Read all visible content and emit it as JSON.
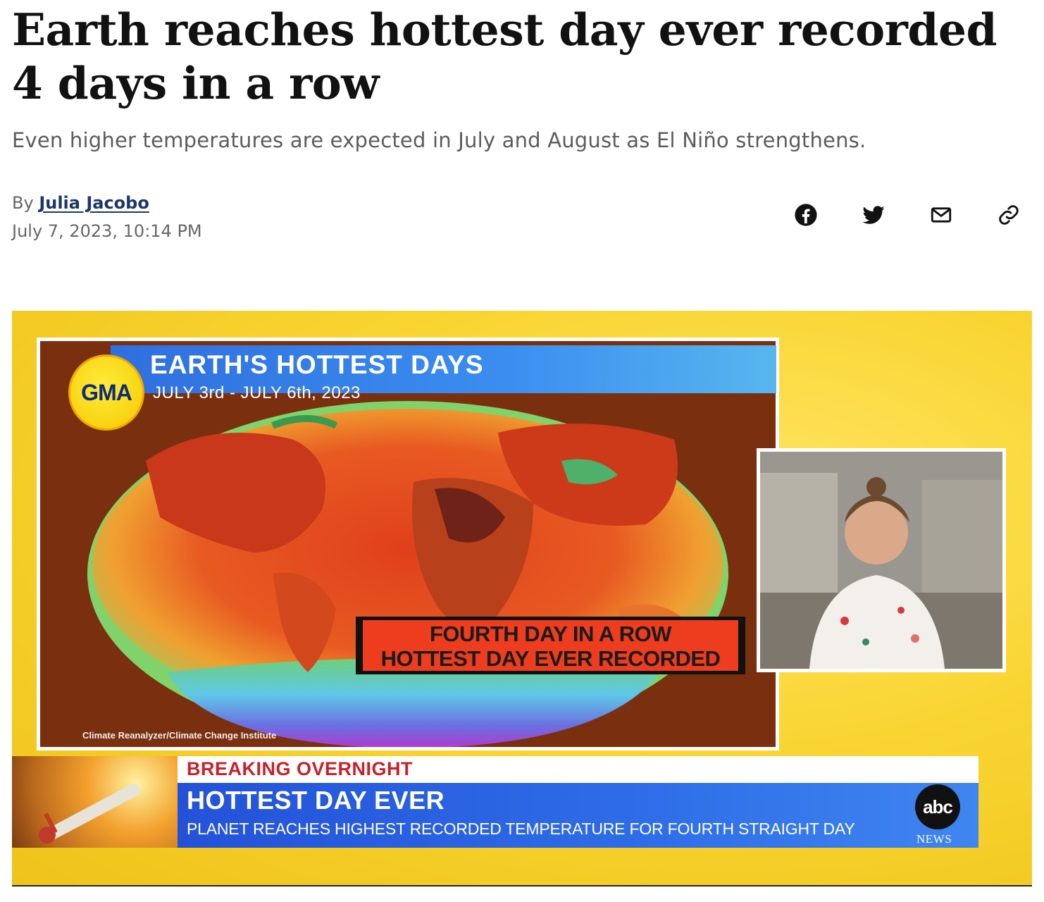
{
  "article": {
    "headline": "Earth reaches hottest day ever recorded 4 days in a row",
    "subhead": "Even higher temperatures are expected in July and August as El Niño strengthens.",
    "byline_prefix": "By",
    "author": "Julia Jacobo",
    "timestamp": "July 7, 2023, 10:14 PM"
  },
  "share": {
    "icons": [
      "facebook-icon",
      "twitter-icon",
      "email-icon",
      "link-icon"
    ]
  },
  "media": {
    "gma_logo": "GMA",
    "title": "EARTH'S HOTTEST DAYS",
    "dates": "JULY 3rd - JULY 6th, 2023",
    "callout_line1": "FOURTH DAY IN A ROW",
    "callout_line2": "HOTTEST DAY EVER RECORDED",
    "credit": "Climate Reanalyzer/Climate Change Institute",
    "breaking": "BREAKING OVERNIGHT",
    "hottest": "HOTTEST DAY EVER",
    "planet": "PLANET REACHES HIGHEST RECORDED TEMPERATURE FOR FOURTH STRAIGHT DAY",
    "abc_logo": "abc",
    "abc_news": "NEWS"
  },
  "colors": {
    "author_link": "#1b3668",
    "breaking_red": "#c9202a",
    "banner_blue": "#2f6ee8",
    "callout_red": "#ed3c1e",
    "gma_yellow": "#f5c800"
  }
}
